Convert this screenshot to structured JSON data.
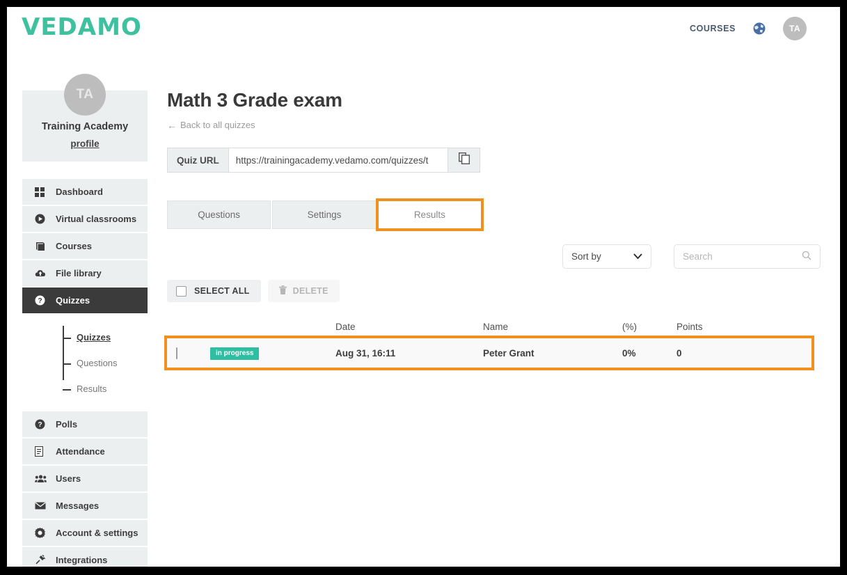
{
  "header": {
    "logo_text": "VEDAMO",
    "courses_label": "COURSES",
    "globe_icon": "globe-icon",
    "avatar_initials": "TA"
  },
  "sidebar": {
    "profile": {
      "avatar_initials": "TA",
      "name": "Training Academy",
      "profile_link": "profile"
    },
    "items": [
      {
        "label": "Dashboard",
        "icon": "grid-icon",
        "active": false
      },
      {
        "label": "Virtual classrooms",
        "icon": "play-circle-icon",
        "active": false
      },
      {
        "label": "Courses",
        "icon": "book-icon",
        "active": false
      },
      {
        "label": "File library",
        "icon": "cloud-upload-icon",
        "active": false
      },
      {
        "label": "Quizzes",
        "icon": "question-circle-icon",
        "active": true
      }
    ],
    "subitems": [
      {
        "label": "Quizzes",
        "active": true
      },
      {
        "label": "Questions",
        "active": false
      },
      {
        "label": "Results",
        "active": false
      }
    ],
    "items_bottom": [
      {
        "label": "Polls",
        "icon": "question-circle-icon"
      },
      {
        "label": "Attendance",
        "icon": "document-icon"
      },
      {
        "label": "Users",
        "icon": "users-icon"
      },
      {
        "label": "Messages",
        "icon": "envelope-icon"
      },
      {
        "label": "Account & settings",
        "icon": "gear-icon"
      },
      {
        "label": "Integrations",
        "icon": "plug-icon"
      }
    ]
  },
  "main": {
    "title": "Math 3 Grade exam",
    "back_link": "Back to all quizzes",
    "back_arrow": "←",
    "quiz_url": {
      "label": "Quiz URL",
      "value": "https://trainingacademy.vedamo.com/quizzes/t",
      "copy_icon": "copy-icon"
    },
    "tabs": [
      {
        "label": "Questions",
        "active": false,
        "highlighted": false
      },
      {
        "label": "Settings",
        "active": false,
        "highlighted": false
      },
      {
        "label": "Results",
        "active": true,
        "highlighted": true
      }
    ],
    "controls": {
      "sort_by_label": "Sort by",
      "sort_by_chevron": "chevron-down-icon",
      "search_placeholder": "Search",
      "search_value": "",
      "search_icon": "search-icon"
    },
    "actions": {
      "select_all_label": "SELECT ALL",
      "delete_label": "DELETE",
      "delete_icon": "trash-icon",
      "delete_disabled": true
    },
    "table": {
      "columns": [
        "",
        "",
        "Date",
        "Name",
        "(%)",
        "Points"
      ],
      "rows": [
        {
          "checked": false,
          "status": "in progress",
          "date": "Aug 31, 16:11",
          "name": "Peter Grant",
          "percent": "0%",
          "points": "0",
          "highlighted": true
        }
      ]
    }
  },
  "colors": {
    "brand_teal": "#3fc1a0",
    "badge_teal": "#2ebfa2",
    "annotation_orange": "#f0901e",
    "sidebar_bg": "#eceff0",
    "active_nav_bg": "#3b3b3b",
    "frame_black": "#000000"
  }
}
